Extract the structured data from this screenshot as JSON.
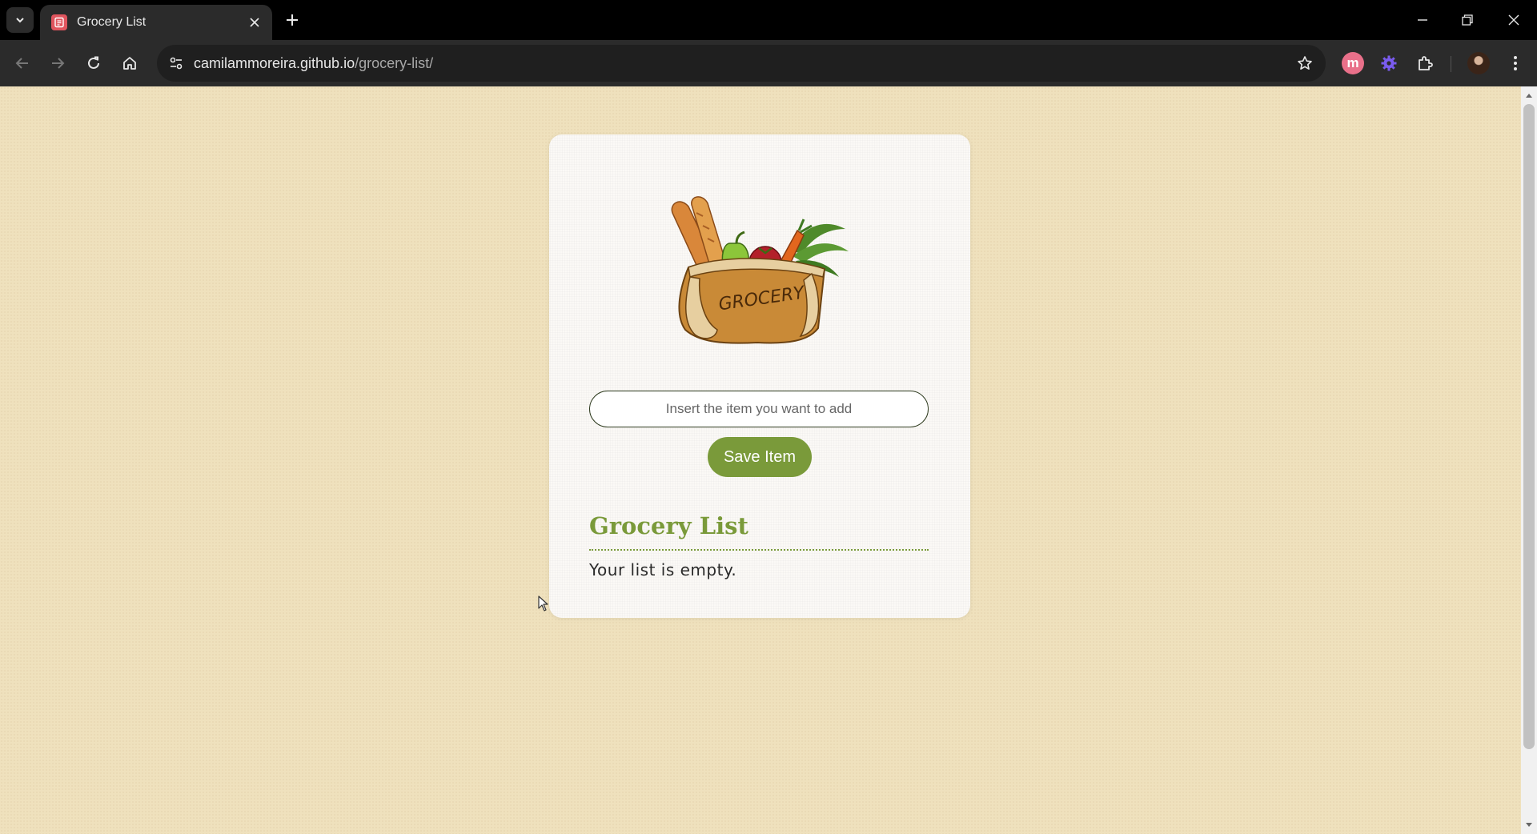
{
  "browser": {
    "tab_title": "Grocery List",
    "url_domain": "camilammoreira.github.io",
    "url_path": "/grocery-list/",
    "extension_m_label": "m"
  },
  "icons": {
    "tab_search": "chevron-down-icon",
    "favicon": "list-icon",
    "tab_close": "close-icon",
    "new_tab": "plus-icon",
    "minimize": "minimize-icon",
    "restore": "restore-icon",
    "close_window": "close-icon",
    "back": "back-arrow-icon",
    "forward": "forward-arrow-icon",
    "reload": "reload-icon",
    "home": "home-icon",
    "site_info": "tune-icon",
    "bookmark": "star-icon",
    "extension_gear": "gear-icon",
    "extensions": "puzzle-icon",
    "profile": "avatar",
    "menu": "kebab-menu-icon"
  },
  "colors": {
    "page_background": "#efe1bd",
    "accent_green": "#7a9a3a",
    "card_background": "#fbf9f6"
  },
  "app": {
    "logo_text": "GROCERY",
    "input_placeholder": "Insert the item you want to add",
    "input_value": "",
    "save_button_label": "Save Item",
    "list_title": "Grocery List",
    "empty_message": "Your list is empty."
  }
}
